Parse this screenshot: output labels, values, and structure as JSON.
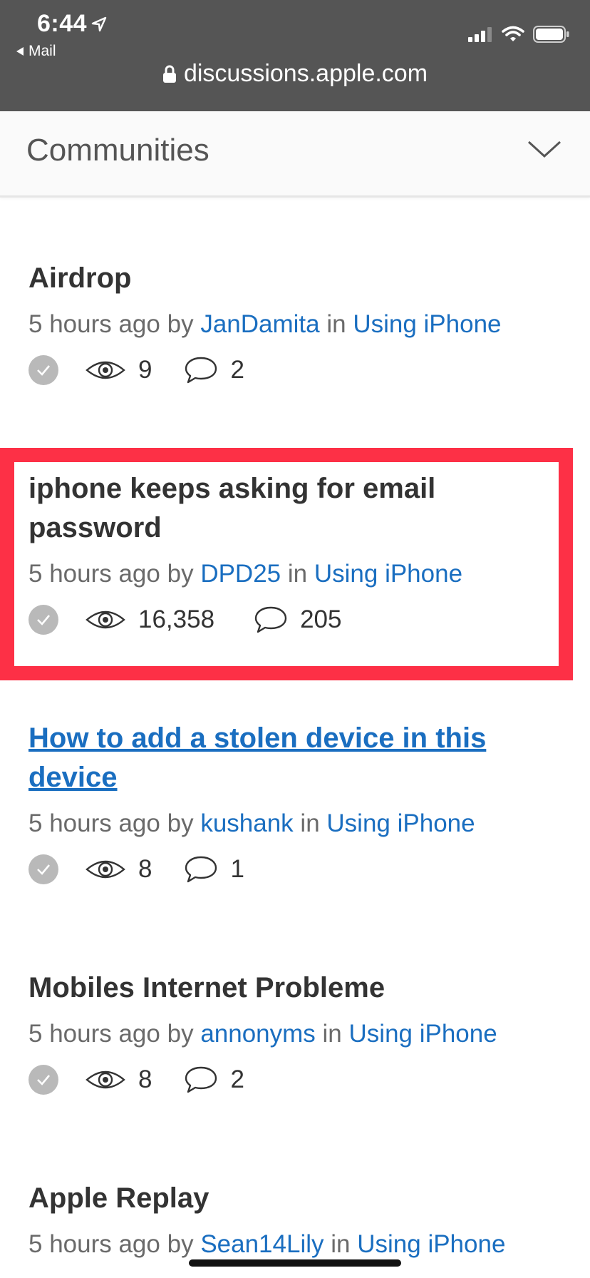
{
  "status_bar": {
    "time": "6:44",
    "back_label": "Mail",
    "url": "discussions.apple.com"
  },
  "header": {
    "title": "Communities"
  },
  "threads": [
    {
      "title": "Airdrop",
      "time": "5 hours ago",
      "by": "by",
      "author": "JanDamita",
      "in": "in",
      "community": "Using iPhone",
      "views": "9",
      "replies": "2",
      "highlighted": false,
      "visited_link": false
    },
    {
      "title": "iphone keeps asking for email password",
      "time": "5 hours ago",
      "by": "by",
      "author": "DPD25",
      "in": "in",
      "community": "Using iPhone",
      "views": "16,358",
      "replies": "205",
      "highlighted": true,
      "visited_link": false
    },
    {
      "title": "How to add a stolen device in this device",
      "time": "5 hours ago",
      "by": "by",
      "author": "kushank",
      "in": "in",
      "community": "Using iPhone",
      "views": "8",
      "replies": "1",
      "highlighted": false,
      "visited_link": true
    },
    {
      "title": "Mobiles Internet Probleme",
      "time": "5 hours ago",
      "by": "by",
      "author": "annonyms",
      "in": "in",
      "community": "Using iPhone",
      "views": "8",
      "replies": "2",
      "highlighted": false,
      "visited_link": false
    },
    {
      "title": "Apple Replay",
      "time": "5 hours ago",
      "by": "by",
      "author": "Sean14Lily",
      "in": "in",
      "community": "Using iPhone",
      "highlighted": false,
      "visited_link": false
    }
  ],
  "colors": {
    "link": "#1a6ec0",
    "highlight_border": "#fd3046",
    "topbar": "#555555"
  },
  "icons": [
    "location-arrow-icon",
    "back-triangle-icon",
    "signal-icon",
    "wifi-icon",
    "battery-icon",
    "lock-icon",
    "chevron-down-icon",
    "solved-check-icon",
    "views-eye-icon",
    "replies-bubble-icon"
  ]
}
